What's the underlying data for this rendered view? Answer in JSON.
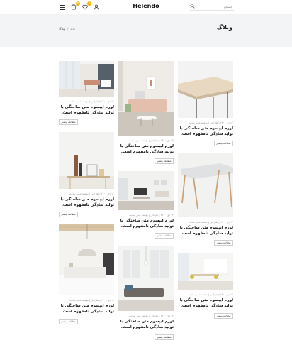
{
  "header": {
    "logo": "Helendo",
    "search_placeholder": "جستجو",
    "cart_count": "0",
    "wishlist_count": "0"
  },
  "banner": {
    "title": "وبلاگ",
    "breadcrumb_home": "خانه",
    "breadcrumb_current": "وبلاگ"
  },
  "posts": [
    {
      "meta": "۱۴ دی ۱۴۰۰  |  طراحی  |  نوشته مدیر سایت",
      "title": "لورم ایپسوم متن ساختگی با تولید سادگی نامفهوم است.",
      "button": "مطالعه بیشتر"
    },
    {
      "meta": "۱۴ دی ۱۴۰۰  |  طراحی  |  نوشته مدیر سایت",
      "title": "لورم ایپسوم متن ساختگی با تولید سادگی نامفهوم است.",
      "button": "مطالعه بیشتر"
    },
    {
      "meta": "۱۴ دی ۱۴۰۰  |  طراحی  |  نوشته مدیر سایت",
      "title": "لورم ایپسوم متن ساختگی با تولید سادگی نامفهوم است.",
      "button": "مطالعه بیشتر"
    },
    {
      "meta": "۱۴ دی ۱۴۰۰  |  طراحی  |  نوشته مدیر سایت",
      "title": "لورم ایپسوم متن ساختگی با تولید سادگی نامفهوم است.",
      "button": "مطالعه بیشتر"
    },
    {
      "meta": "۱۴ دی ۱۴۰۰  |  طراحی  |  نوشته مدیر سایت",
      "title": "لورم ایپسوم متن ساختگی با تولید سادگی نامفهوم است.",
      "button": "مطالعه بیشتر"
    },
    {
      "meta": "۱۴ دی ۱۴۰۰  |  طراحی  |  نوشته مدیر سایت",
      "title": "لورم ایپسوم متن ساختگی با تولید سادگی نامفهوم است.",
      "button": "مطالعه بیشتر"
    },
    {
      "meta": "۱۴ دی ۱۴۰۰  |  طراحی  |  نوشته مدیر سایت",
      "title": "لورم ایپسوم متن ساختگی با تولید سادگی نامفهوم است.",
      "button": "مطالعه بیشتر"
    },
    {
      "meta": "۱۴ دی ۱۴۰۰  |  طراحی  |  نوشته مدیر سایت",
      "title": "لورم ایپسوم متن ساختگی با تولید سادگی نامفهوم است.",
      "button": "مطالعه بیشتر"
    },
    {
      "meta": "۱۴ دی ۱۴۰۰  |  طراحی  |  نوشته مدیر سایت",
      "title": "لورم ایپسوم متن ساختگی با تولید سادگی نامفهوم است.",
      "button": "مطالعه بیشتر"
    }
  ],
  "colors": {
    "banner_bg": "#f3f4f5",
    "badge": "#f0b400"
  }
}
